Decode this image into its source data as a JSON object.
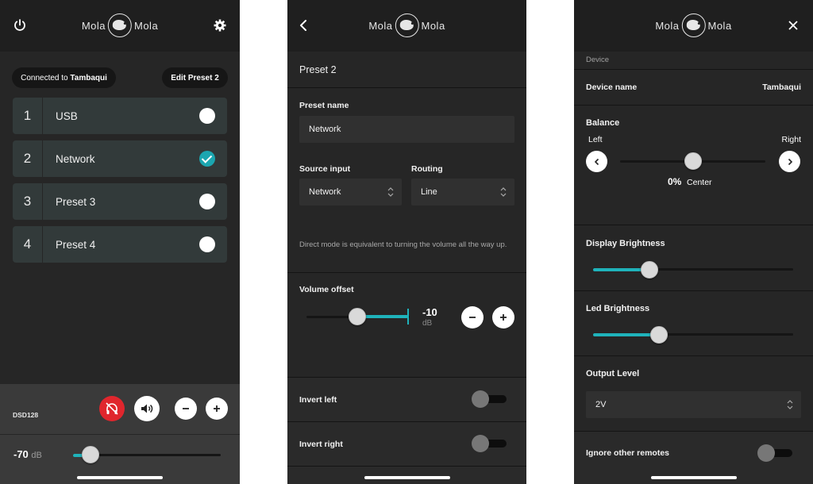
{
  "logo": {
    "left_word": "Mola",
    "right_word": "Mola"
  },
  "screen1": {
    "connected_prefix": "Connected to",
    "connected_device": "Tambaqui",
    "edit_preset": "Edit Preset 2",
    "presets": [
      {
        "num": "1",
        "label": "USB",
        "selected": false
      },
      {
        "num": "2",
        "label": "Network",
        "selected": true
      },
      {
        "num": "3",
        "label": "Preset 3",
        "selected": false
      },
      {
        "num": "4",
        "label": "Preset 4",
        "selected": false
      }
    ],
    "footer_source": "DSD128",
    "volume_value": "-70",
    "volume_unit": "dB",
    "volume_level": 0.12
  },
  "screen2": {
    "title": "Preset 2",
    "preset_name_label": "Preset name",
    "preset_name_value": "Network",
    "source_label": "Source input",
    "source_value": "Network",
    "routing_label": "Routing",
    "routing_value": "Line",
    "direct_note": "Direct mode is equivalent to turning the volume all the way up.",
    "volume_offset_label": "Volume offset",
    "offset_value": "-10",
    "offset_unit": "dB",
    "invert_left": "Invert left",
    "invert_right": "Invert right"
  },
  "screen3": {
    "section": "Device",
    "device_name_label": "Device name",
    "device_name_value": "Tambaqui",
    "balance_label": "Balance",
    "left": "Left",
    "right": "Right",
    "balance_value": "0%",
    "balance_desc": "Center",
    "display_brightness": "Display Brightness",
    "display_level": 0.28,
    "led_brightness": "Led Brightness",
    "led_level": 0.33,
    "output_level_label": "Output Level",
    "output_level_value": "2V",
    "ignore_remotes": "Ignore other remotes"
  },
  "colors": {
    "accent": "#1fb3bb",
    "mute": "#e0262d"
  }
}
